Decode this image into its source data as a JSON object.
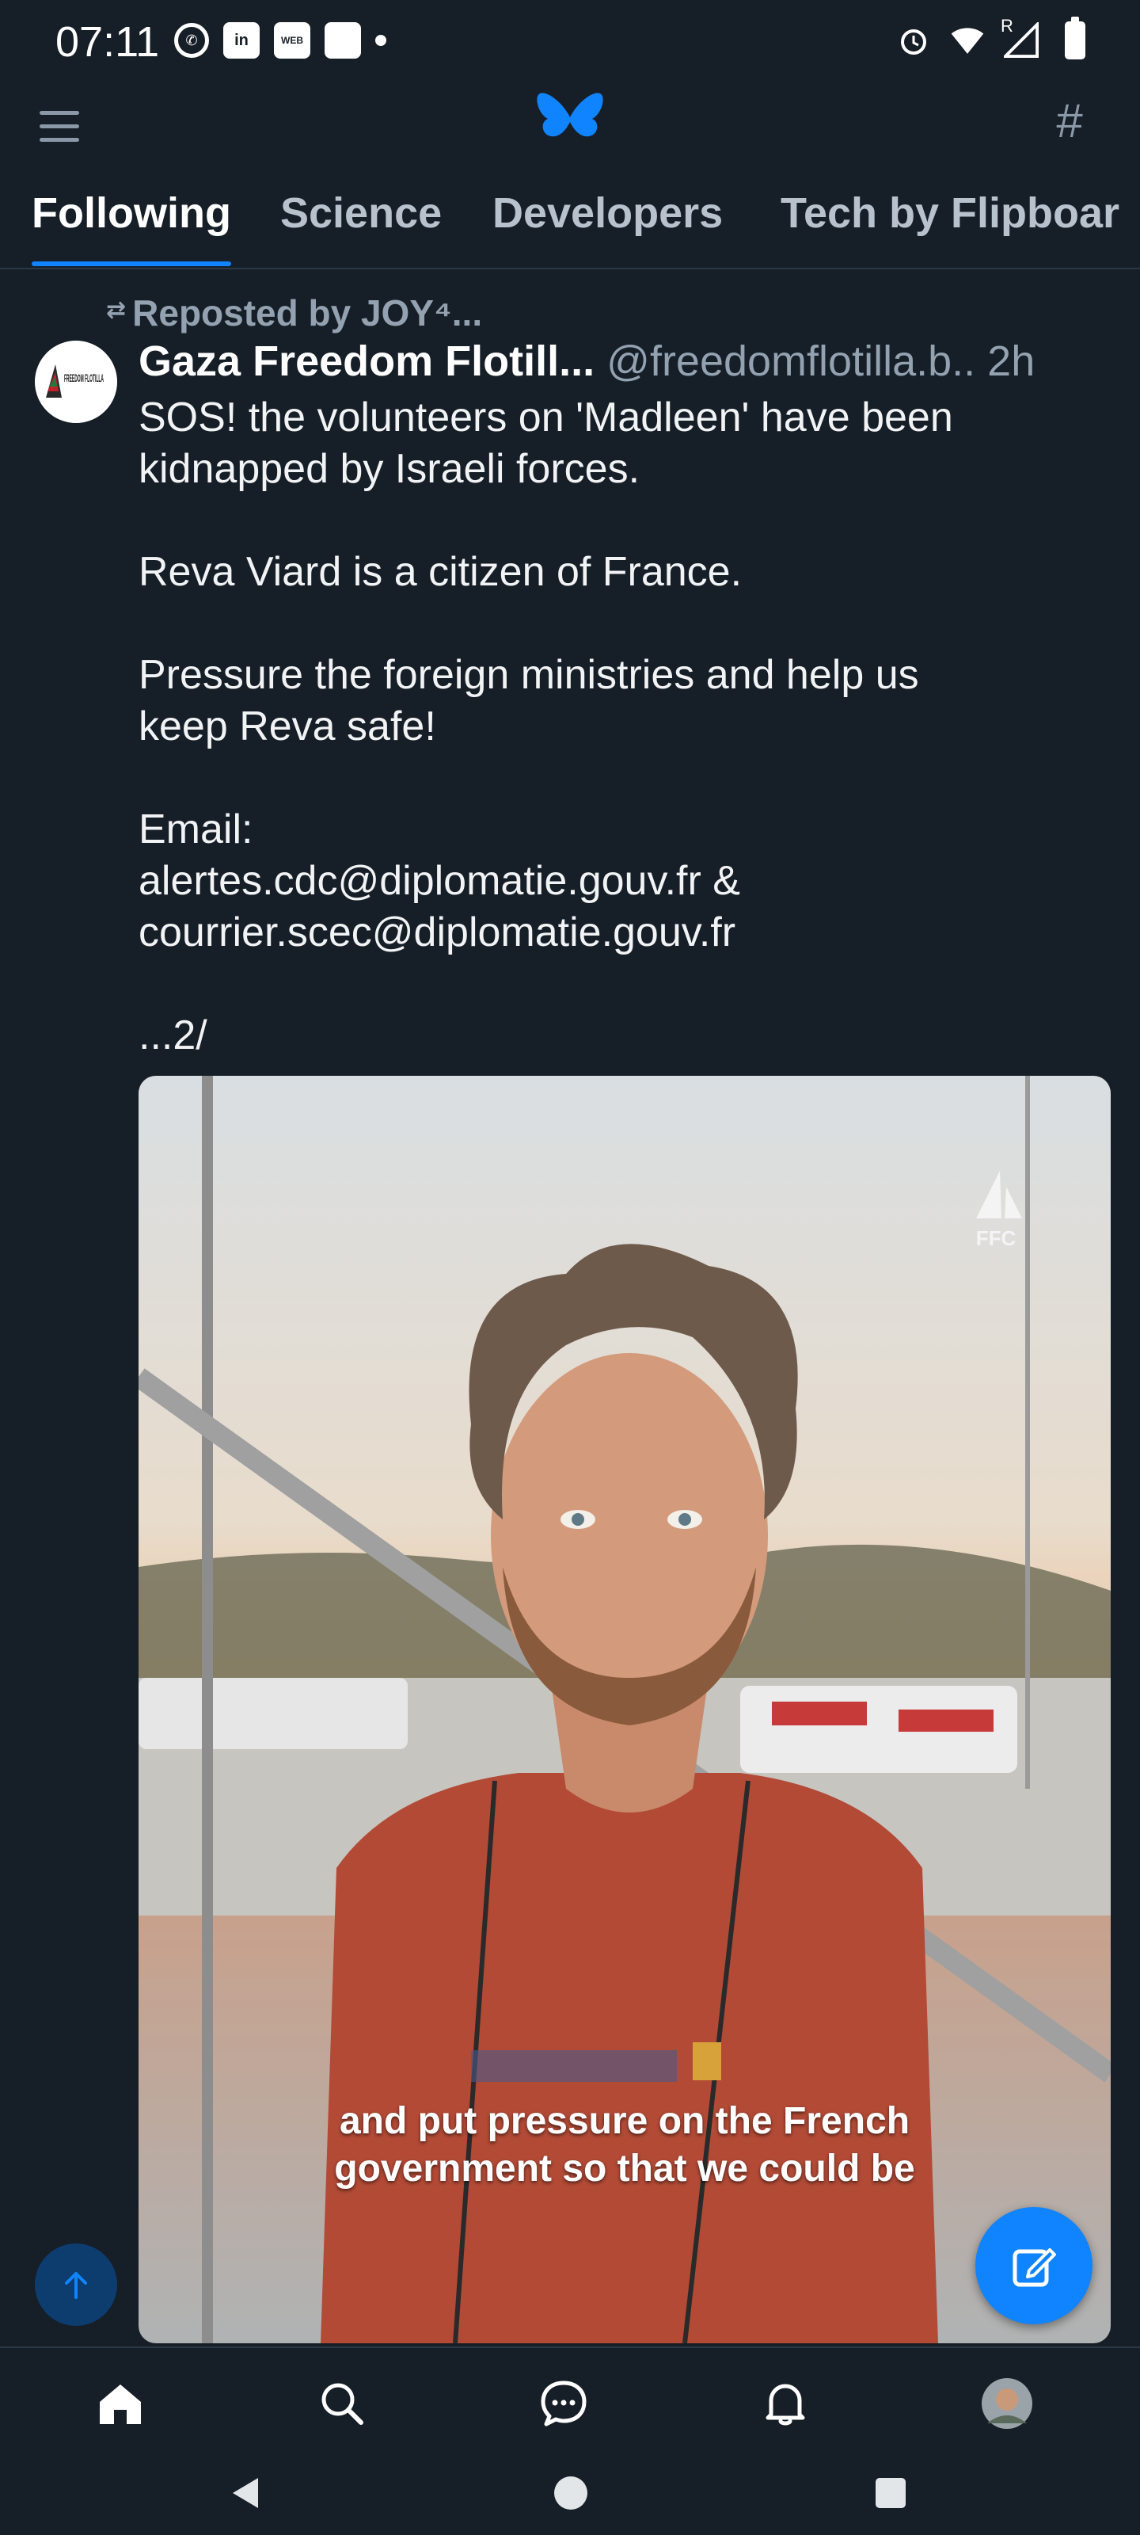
{
  "status_bar": {
    "time": "07:11",
    "left_icons": [
      "whatsapp-icon",
      "linkedin-icon",
      "webtoon-icon",
      "square-icon",
      "dot-icon"
    ],
    "right_icons": [
      "alarm-icon",
      "wifi-icon",
      "signal-icon",
      "battery-icon"
    ],
    "signal_label": "R"
  },
  "top_bar": {
    "menu_icon": "hamburger-menu-icon",
    "logo_icon": "butterfly-icon",
    "feeds_icon": "hash-icon",
    "hash_glyph": "#"
  },
  "tabs": [
    {
      "label": "Following",
      "active": true
    },
    {
      "label": "Science",
      "active": false
    },
    {
      "label": "Developers",
      "active": false
    },
    {
      "label": "Tech by Flipboar",
      "active": false
    }
  ],
  "post": {
    "repost_text": "Reposted by JOY⁴...",
    "author": "Gaza Freedom Flotill...",
    "handle": "@freedomflotilla.b..",
    "time": "2h",
    "avatar_text": "FREEDOM FLOTILLA",
    "body": [
      "SOS! the volunteers on 'Madleen' have been\nkidnapped by Israeli forces.",
      "Reva Viard is a citizen of France.",
      "Pressure the foreign ministries and help us\nkeep Reva safe!",
      "Email:\nalertes.cdc@diplomatie.gouv.fr &\ncourrier.scec@diplomatie.gouv.fr",
      "...2/"
    ],
    "video": {
      "caption_line1": "and put pressure on the French",
      "caption_line2": "government so that we could be",
      "watermark": "FFC"
    }
  },
  "floating": {
    "scroll_top_icon": "arrow-up-icon",
    "compose_icon": "compose-icon"
  },
  "bottom_nav": [
    "home-icon",
    "search-icon",
    "chat-icon",
    "bell-icon",
    "profile-avatar"
  ],
  "system_nav": [
    "back-icon",
    "home-circle-icon",
    "recents-icon"
  ],
  "colors": {
    "background": "#161e27",
    "accent": "#1083fe",
    "muted": "#93a1b0"
  }
}
